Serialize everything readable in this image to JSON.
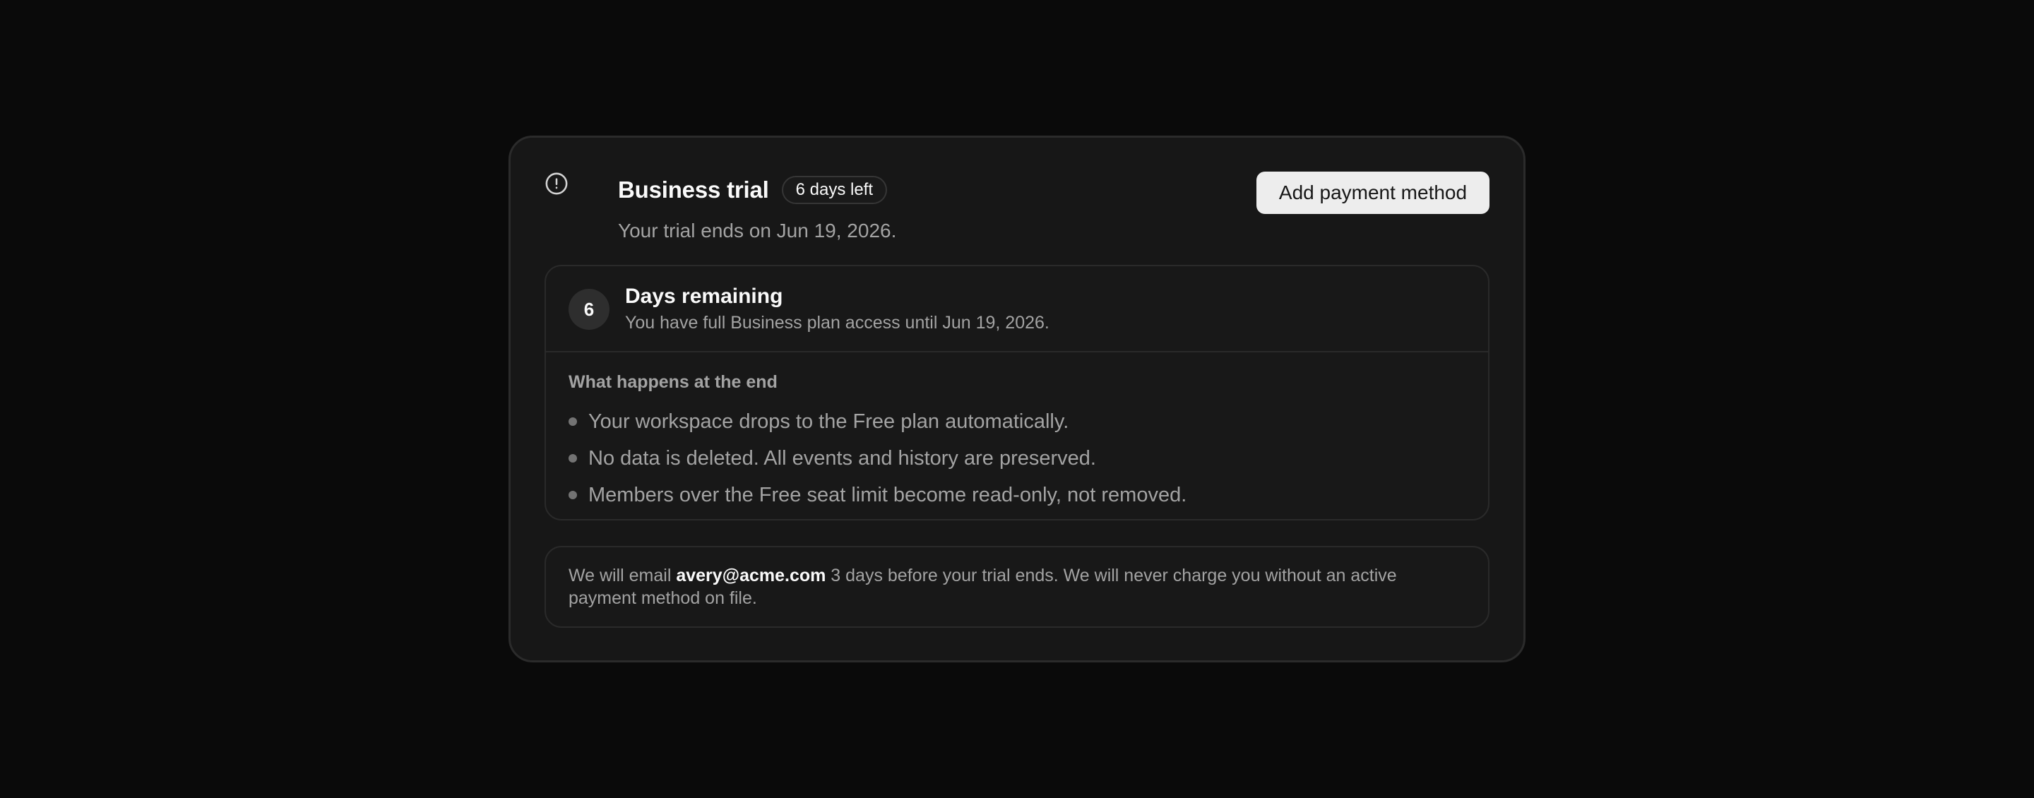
{
  "header": {
    "title": "Business trial",
    "badge": "6 days left",
    "subtitle": "Your trial ends on Jun 19, 2026.",
    "icon": "alert-circle-icon",
    "primary_action": "Add payment method"
  },
  "days": {
    "count": "6",
    "title": "Days remaining",
    "subtitle": "You have full Business plan access until Jun 19, 2026."
  },
  "end": {
    "heading": "What happens at the end",
    "items": [
      "Your workspace drops to the Free plan automatically.",
      "No data is deleted. All events and history are preserved.",
      "Members over the Free seat limit become read-only, not removed."
    ]
  },
  "notice": {
    "prefix": "We will email ",
    "email": "avery@acme.com",
    "suffix": " 3 days before your trial ends. We will never charge you without an active payment method on file."
  },
  "colors": {
    "background": "#0a0a0a",
    "card": "#171717",
    "primary_button": "#ededed",
    "muted_text": "#a3a3a3"
  }
}
